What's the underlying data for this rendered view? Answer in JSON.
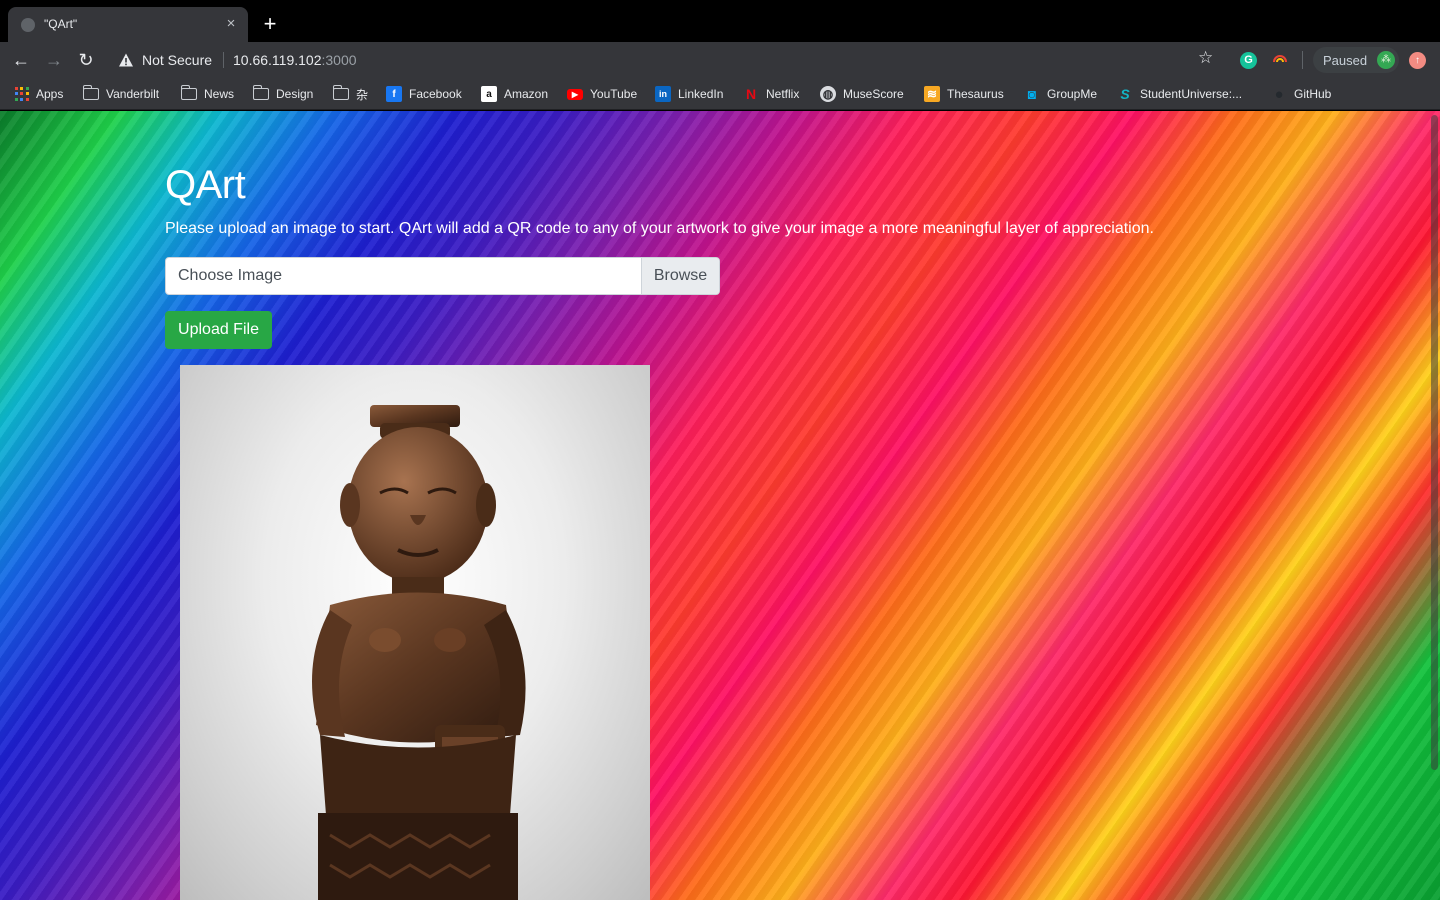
{
  "browser": {
    "tab_title": "\"QArt\"",
    "tab_close": "×",
    "new_tab": "+",
    "nav": {
      "back": "←",
      "forward": "→",
      "reload": "↻"
    },
    "security_label": "Not Secure",
    "url_host": "10.66.119.102",
    "url_port": ":3000",
    "star": "☆",
    "extension_g": "G",
    "profile_label": "Paused",
    "profile_avatar": "⁂",
    "update_badge": "↑"
  },
  "bookmarks": [
    {
      "label": "Apps",
      "icon": "apps-grid-icon"
    },
    {
      "label": "Vanderbilt",
      "icon": "folder-icon"
    },
    {
      "label": "News",
      "icon": "folder-icon"
    },
    {
      "label": "Design",
      "icon": "folder-icon"
    },
    {
      "label": "杂",
      "icon": "folder-icon"
    },
    {
      "label": "Facebook",
      "icon": "facebook-icon",
      "glyph": "f",
      "color": "#1877f2"
    },
    {
      "label": "Amazon",
      "icon": "amazon-icon",
      "glyph": "a",
      "color": "#ffffff"
    },
    {
      "label": "YouTube",
      "icon": "youtube-icon",
      "glyph": "▶",
      "color": "#ff0000"
    },
    {
      "label": "LinkedIn",
      "icon": "linkedin-icon",
      "glyph": "in",
      "color": "#0a66c2"
    },
    {
      "label": "Netflix",
      "icon": "netflix-icon",
      "glyph": "N",
      "color": "#e50914"
    },
    {
      "label": "MuseScore",
      "icon": "globe-icon",
      "glyph": "◍",
      "color": "#dadce0"
    },
    {
      "label": "Thesaurus",
      "icon": "thesaurus-icon",
      "glyph": "≋",
      "color": "#f7a823"
    },
    {
      "label": "GroupMe",
      "icon": "groupme-icon",
      "glyph": "◙",
      "color": "#00aff0"
    },
    {
      "label": "StudentUniverse:...",
      "icon": "studentuniverse-icon",
      "glyph": "S",
      "color": "#13b5c6"
    },
    {
      "label": "GitHub",
      "icon": "github-icon",
      "glyph": "●",
      "color": "#24292e"
    }
  ],
  "page": {
    "title": "QArt",
    "lead": "Please upload an image to start. QArt will add a QR code to any of your artwork to give your image a more meaningful layer of appreciation.",
    "file_placeholder": "Choose Image",
    "browse_label": "Browse",
    "upload_label": "Upload File"
  },
  "colors": {
    "upload_button": "#28a745",
    "toolbar": "#35363a",
    "tabstrip": "#000000"
  }
}
